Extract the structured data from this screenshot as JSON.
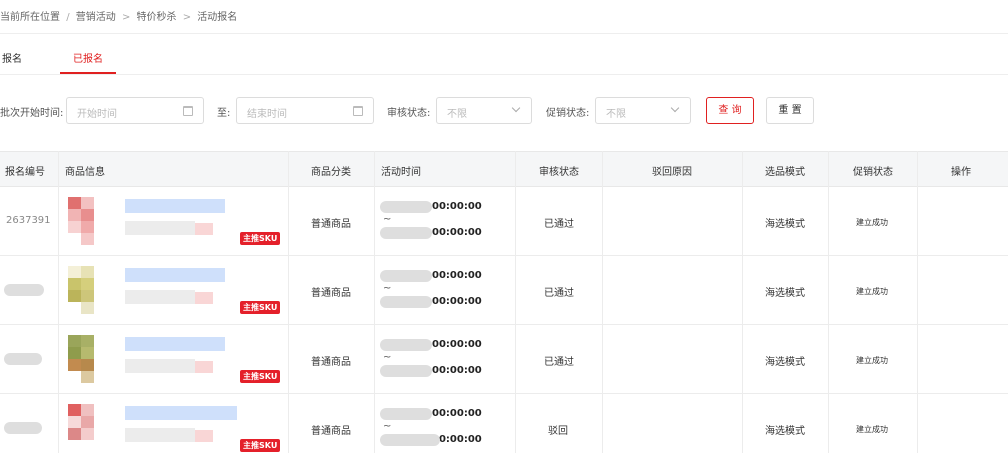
{
  "breadcrumb": {
    "prefix": "当前所在位置",
    "items": [
      "营销活动",
      "特价秒杀",
      "活动报名"
    ]
  },
  "tabs": [
    {
      "label": "报名",
      "active": false
    },
    {
      "label": "已报名",
      "active": true
    }
  ],
  "filters": {
    "start_label": "批次开始时间:",
    "start_placeholder": "开始时间",
    "to_label": "至:",
    "end_placeholder": "结束时间",
    "audit_label": "审核状态:",
    "audit_value": "不限",
    "promo_label": "促销状态:",
    "promo_value": "不限",
    "query_button": "查 询",
    "reset_button": "重 置"
  },
  "table": {
    "columns": [
      "报名编号",
      "商品信息",
      "商品分类",
      "活动时间",
      "审核状态",
      "驳回原因",
      "选品模式",
      "促销状态",
      "操作"
    ],
    "sku_tag": "主推SKU",
    "rows": [
      {
        "id": "2637391",
        "category": "普通商品",
        "time_start": "00:00:00",
        "time_sep": "~",
        "time_end": "00:00:00",
        "audit": "已通过",
        "reason": "",
        "mode": "海选模式",
        "promo": "建立成功"
      },
      {
        "id": "",
        "category": "普通商品",
        "time_start": "00:00:00",
        "time_sep": "~",
        "time_end": "00:00:00",
        "audit": "已通过",
        "reason": "",
        "mode": "海选模式",
        "promo": "建立成功"
      },
      {
        "id": "",
        "category": "普通商品",
        "time_start": "00:00:00",
        "time_sep": "~",
        "time_end": "00:00:00",
        "audit": "已通过",
        "reason": "",
        "mode": "海选模式",
        "promo": "建立成功"
      },
      {
        "id": "",
        "category": "普通商品",
        "time_start": "00:00:00",
        "time_sep": "~",
        "time_end": "00:00:00",
        "audit": "驳回",
        "reason": "",
        "mode": "海选模式",
        "promo": "建立成功"
      }
    ]
  },
  "colors": {
    "accent": "#e02020",
    "sku_tag": "#e4202a",
    "header_bg": "#f5f6f7"
  },
  "icons": [
    "calendar-icon",
    "chevron-down-icon"
  ]
}
